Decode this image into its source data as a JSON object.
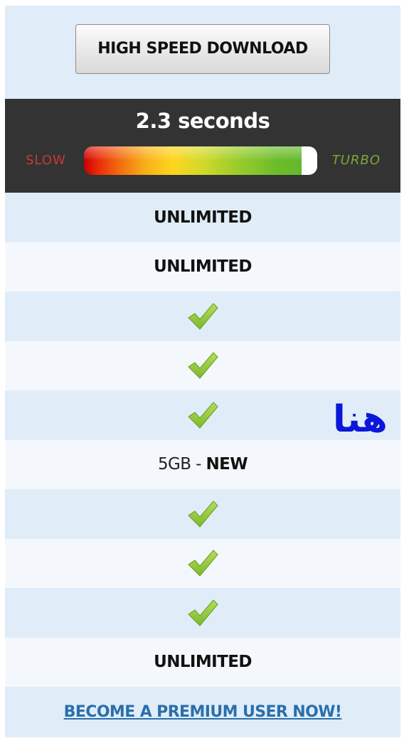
{
  "top": {
    "download_button": "HIGH SPEED DOWNLOAD"
  },
  "speed": {
    "title": "2.3 seconds",
    "slow_label": "SLOW",
    "turbo_label": "TURBO",
    "level": 0.95
  },
  "rows": [
    {
      "type": "text",
      "value": "UNLIMITED"
    },
    {
      "type": "text",
      "value": "UNLIMITED"
    },
    {
      "type": "check",
      "icon": "checkmark-icon"
    },
    {
      "type": "check",
      "icon": "checkmark-icon"
    },
    {
      "type": "check",
      "icon": "checkmark-icon"
    },
    {
      "type": "mixed",
      "prefix": "5GB - ",
      "bold": "NEW"
    },
    {
      "type": "check",
      "icon": "checkmark-icon"
    },
    {
      "type": "check",
      "icon": "checkmark-icon"
    },
    {
      "type": "check",
      "icon": "checkmark-icon"
    },
    {
      "type": "text",
      "value": "UNLIMITED"
    }
  ],
  "cta": {
    "label": "BECOME A PREMIUM USER NOW!"
  },
  "annotation": {
    "text": "هنا"
  },
  "colors": {
    "row_alt": "#e0edf9",
    "speed_bg": "#333333",
    "check_green": "#8cc63f",
    "link": "#2a6fab",
    "annotation": "#0b17d8"
  }
}
